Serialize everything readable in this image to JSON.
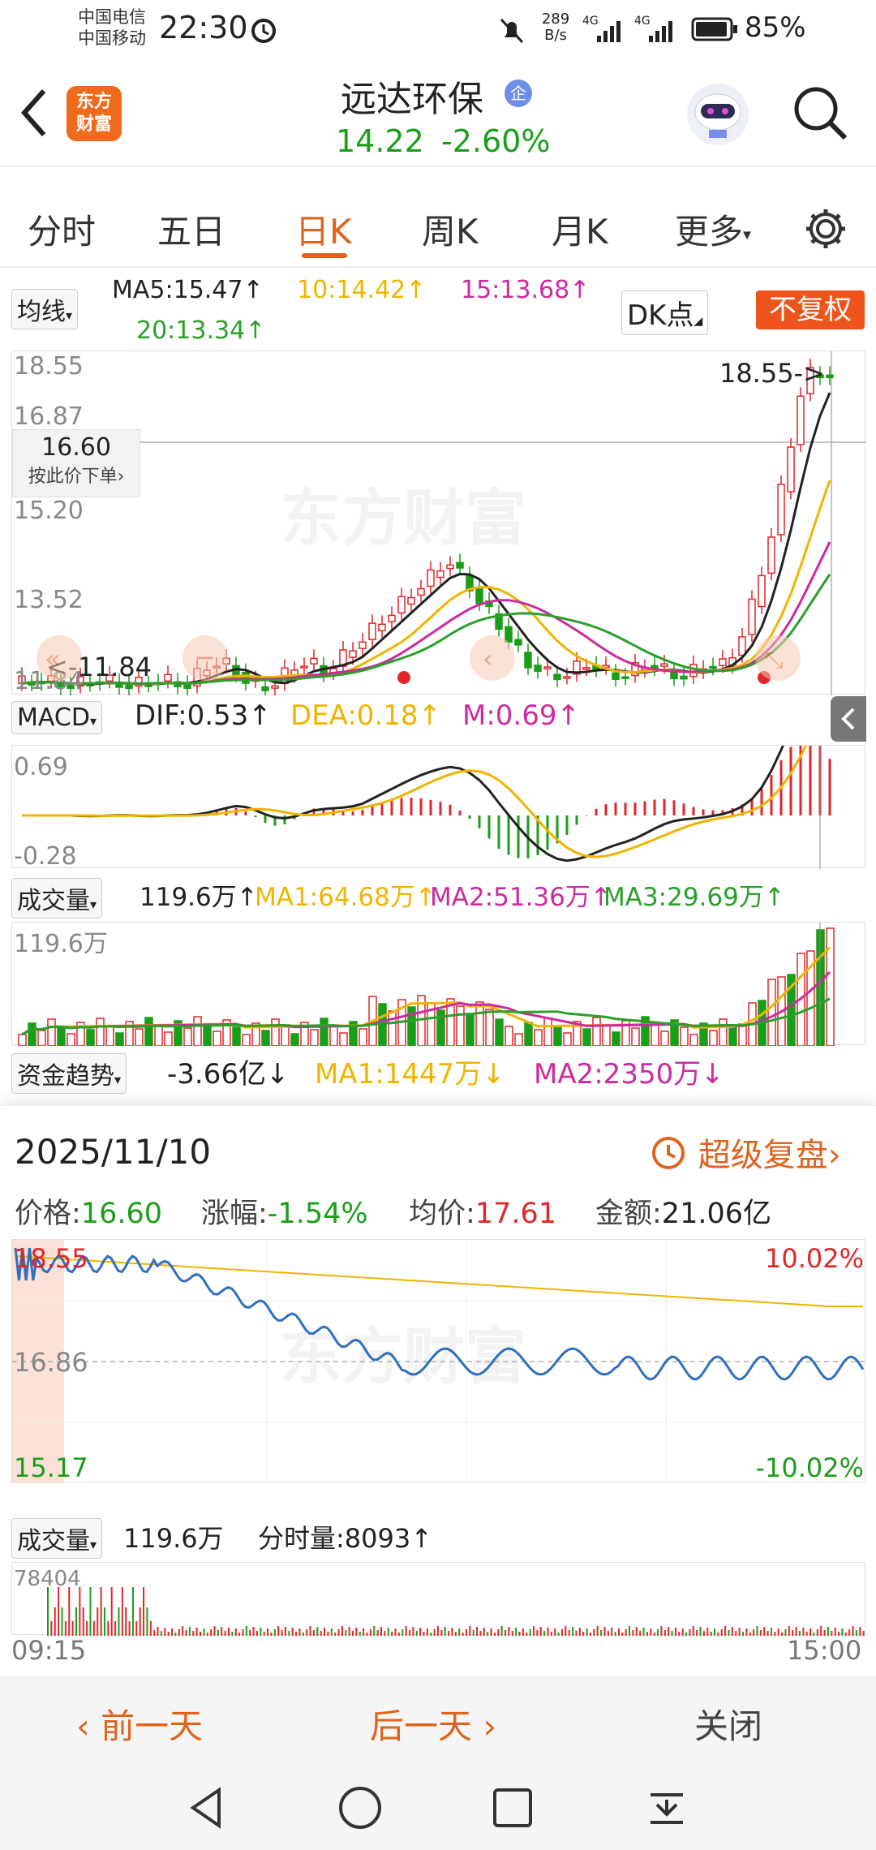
{
  "status": {
    "carrier1": "中国电信",
    "carrier2": "中国移动",
    "time": "22:30",
    "net_speed": "289 B/s",
    "battery": "85%"
  },
  "header": {
    "stock_name": "远达环保",
    "badge": "企",
    "logo_text_1": "东方",
    "logo_text_2": "财富",
    "price": "14.22",
    "change": "-2.60%"
  },
  "tabs": [
    "分时",
    "五日",
    "日K",
    "周K",
    "月K",
    "更多"
  ],
  "ma_bar": {
    "dropdown": "均线",
    "ma5": "MA5:15.47↑",
    "ma10": "10:14.42↑",
    "ma15": "15:13.68↑",
    "ma20": "20:13.34↑",
    "dk_button": "DK点",
    "fq_button": "不复权"
  },
  "kline": {
    "y_labels": [
      "18.55",
      "16.87",
      "15.20",
      "13.52",
      "11.84"
    ],
    "high_label": "18.55->",
    "low_label": "<-11.84",
    "crosshair_price": "16.60",
    "crosshair_hint": "按此价下单",
    "watermark": "东方财富"
  },
  "macd": {
    "dropdown": "MACD",
    "dif": "DIF:0.53↑",
    "dea": "DEA:0.18↑",
    "m": "M:0.69↑",
    "y_top": "0.69",
    "y_bottom": "-0.28"
  },
  "volume": {
    "dropdown": "成交量",
    "val": "119.6万↑",
    "ma1": "MA1:64.68万↑",
    "ma2": "MA2:51.36万↑",
    "ma3": "MA3:29.69万↑",
    "y_top": "119.6万"
  },
  "fund": {
    "dropdown": "资金趋势",
    "val": "-3.66亿↓",
    "ma1": "MA1:1447万↓",
    "ma2": "MA2:2350万↓"
  },
  "intraday": {
    "date": "2025/11/10",
    "replay": "超级复盘",
    "price_label": "价格:",
    "price": "16.60",
    "chg_label": "涨幅:",
    "chg": "-1.54%",
    "avg_label": "均价:",
    "avg": "17.61",
    "amt_label": "金额:",
    "amt": "21.06亿",
    "y_top": "18.55",
    "y_mid": "16.86",
    "y_bottom": "15.17",
    "pct_top": "10.02%",
    "pct_bottom": "-10.02%",
    "vol_dropdown": "成交量",
    "vol": "119.6万",
    "tick_vol": "分时量:8093↑",
    "vol_max": "78404",
    "t_start": "09:15",
    "t_end": "15:00"
  },
  "bottom": {
    "prev": "前一天",
    "next": "后一天",
    "close": "关闭"
  },
  "colors": {
    "up": "#e0262b",
    "down": "#1a9e1a",
    "accent": "#e0631d",
    "ma5": "#222222",
    "ma10": "#f0b400",
    "ma15": "#cc2a9e",
    "ma20": "#2aa02a"
  }
}
